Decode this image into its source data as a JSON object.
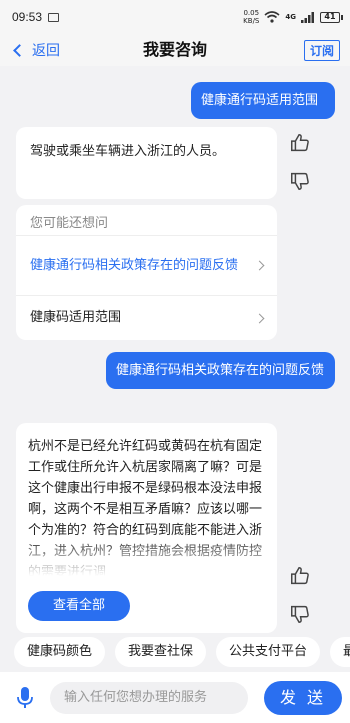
{
  "status_bar": {
    "time": "09:53",
    "speed_top": "0.05",
    "speed_bottom": "KB/S",
    "signal_label": "4G",
    "battery": "41"
  },
  "nav": {
    "back_label": "返回",
    "title": "我要咨询",
    "subscribe_label": "订阅"
  },
  "messages": {
    "user_1": "健康通行码适用范围",
    "answer_1": "驾驶或乘坐车辆进入浙江的人员。",
    "suggest": {
      "header": "您可能还想问",
      "items": [
        {
          "label": "健康通行码相关政策存在的问题反馈",
          "highlighted": true
        },
        {
          "label": "健康码适用范围",
          "highlighted": false
        }
      ]
    },
    "user_2": "健康通行码相关政策存在的问题反馈",
    "answer_2": "杭州不是已经允许红码或黄码在杭有固定工作或住所允许入杭居家隔离了嘛？可是这个健康出行申报不是绿码根本没法申报啊，这两个不是相互矛盾嘛？应该以哪一个为准的？符合的红码到底能不能进入浙江，进入杭州？管控措施会根据疫情防控的需要进行调",
    "view_all_label": "查看全部"
  },
  "quick_chips": [
    "健康码颜色",
    "我要查社保",
    "公共支付平台",
    "最"
  ],
  "input": {
    "placeholder": "输入任何您想办理的服务",
    "send_label": "发 送"
  },
  "colors": {
    "accent": "#2a6ff0",
    "background": "#f2f2f4"
  },
  "icons": [
    "thumbs-up-icon",
    "thumbs-down-icon",
    "mic-icon",
    "chevron-left-icon",
    "chevron-right-icon"
  ]
}
